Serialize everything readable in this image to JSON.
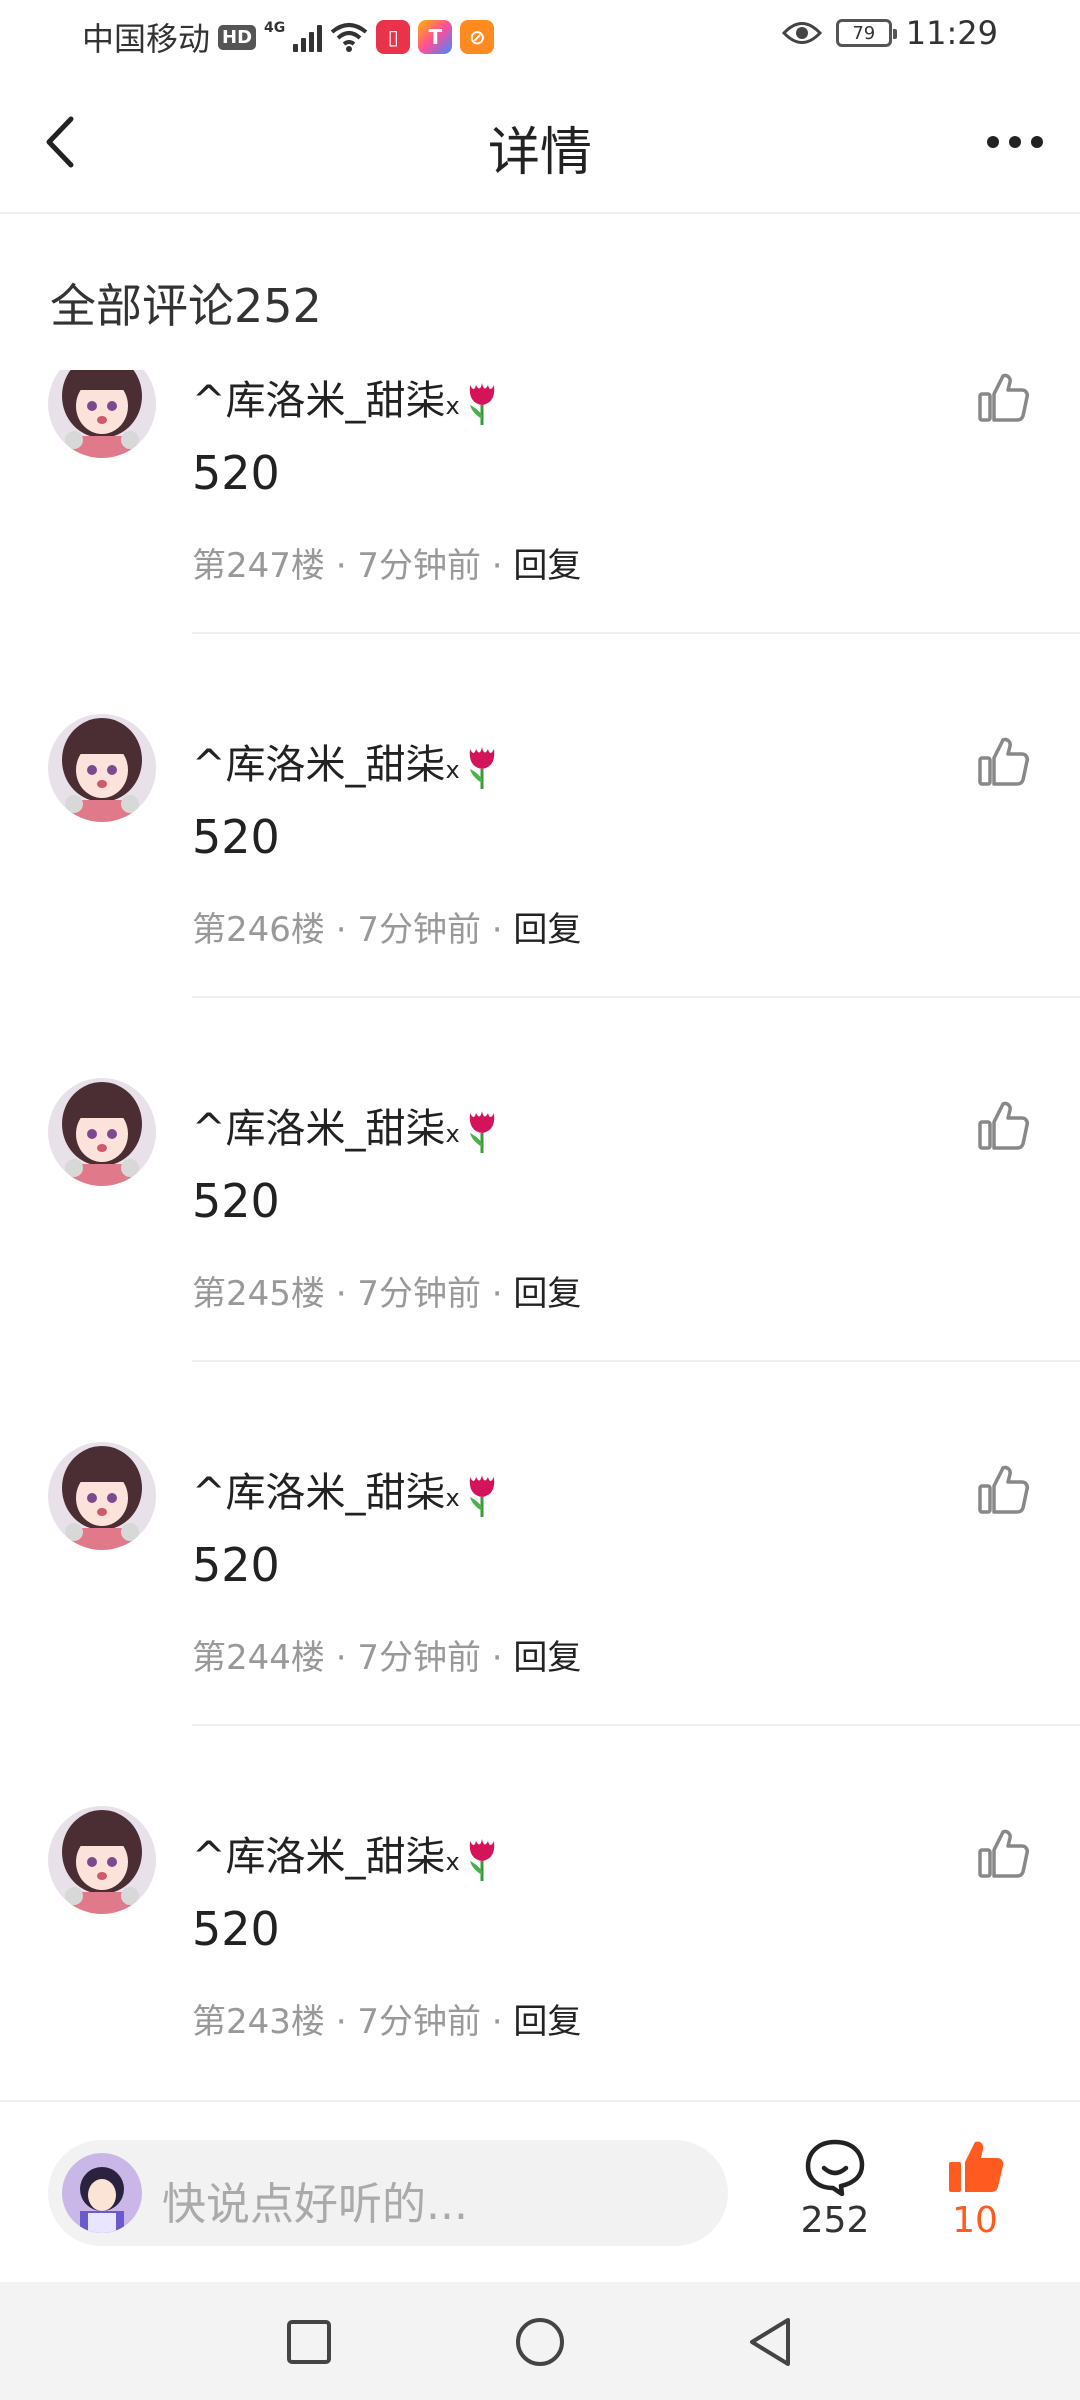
{
  "status_bar": {
    "carrier": "中国移动",
    "hd": "HD",
    "network": "4G",
    "battery": "79",
    "time": "11:29"
  },
  "nav": {
    "title": "详情"
  },
  "section": {
    "title": "全部评论252"
  },
  "comments": [
    {
      "username": "^库洛米_甜柒",
      "suffix": "x",
      "content": "520",
      "floor": "第247楼",
      "time": "7分钟前",
      "reply": "回复"
    },
    {
      "username": "^库洛米_甜柒",
      "suffix": "x",
      "content": "520",
      "floor": "第246楼",
      "time": "7分钟前",
      "reply": "回复"
    },
    {
      "username": "^库洛米_甜柒",
      "suffix": "x",
      "content": "520",
      "floor": "第245楼",
      "time": "7分钟前",
      "reply": "回复"
    },
    {
      "username": "^库洛米_甜柒",
      "suffix": "x",
      "content": "520",
      "floor": "第244楼",
      "time": "7分钟前",
      "reply": "回复"
    },
    {
      "username": "^库洛米_甜柒",
      "suffix": "x",
      "content": "520",
      "floor": "第243楼",
      "time": "7分钟前",
      "reply": "回复"
    }
  ],
  "meta_separator": " · ",
  "bottom_bar": {
    "placeholder": "快说点好听的...",
    "comment_count": "252",
    "like_count": "10"
  },
  "colors": {
    "accent": "#ff5a1f",
    "meta": "#999999",
    "divider": "#eeeeee"
  },
  "icons": [
    "back-icon",
    "more-icon",
    "thumbs-up-icon",
    "tulip-icon",
    "comment-bubble-icon",
    "thumbs-up-filled-icon",
    "recent-apps-icon",
    "home-icon",
    "back-triangle-icon"
  ]
}
